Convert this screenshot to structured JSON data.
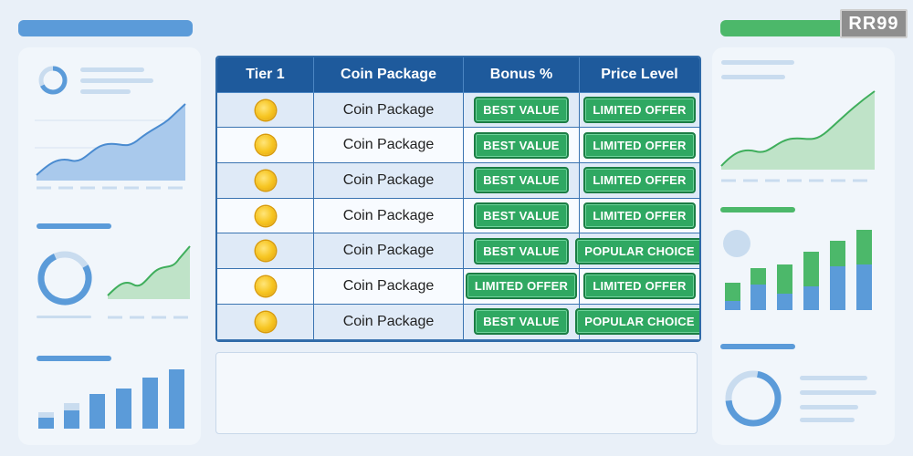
{
  "logo": {
    "text": "RR99"
  },
  "table": {
    "headers": [
      "Tier 1",
      "Coin Package",
      "Bonus %",
      "Price Level"
    ],
    "rows": [
      {
        "package": "Coin Package",
        "bonus": "BEST VALUE",
        "price": "LIMITED OFFER"
      },
      {
        "package": "Coin Package",
        "bonus": "BEST VALUE",
        "price": "LIMITED OFFER"
      },
      {
        "package": "Coin Package",
        "bonus": "BEST VALUE",
        "price": "LIMITED OFFER"
      },
      {
        "package": "Coin Package",
        "bonus": "BEST VALUE",
        "price": "LIMITED OFFER"
      },
      {
        "package": "Coin Package",
        "bonus": "BEST VALUE",
        "price": "POPULAR CHOICE"
      },
      {
        "package": "Coin Package",
        "bonus": "LIMITED OFFER",
        "price": "LIMITED OFFER"
      },
      {
        "package": "Coin Package",
        "bonus": "BEST VALUE",
        "price": "POPULAR CHOICE"
      }
    ]
  },
  "colors": {
    "blue_accent": "#5b9bd9",
    "green_accent": "#4cb86a",
    "header": "#1e5a9c",
    "badge": "#2fa862"
  },
  "icons": {
    "row_icon": "coin-icon"
  }
}
